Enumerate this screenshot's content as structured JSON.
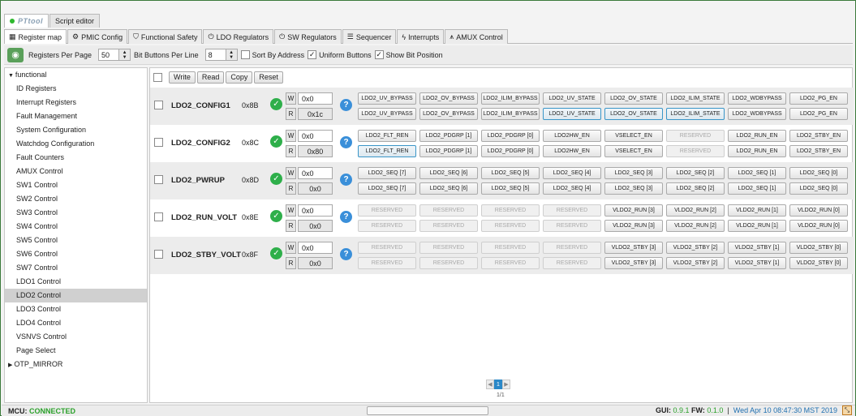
{
  "app_tabs": [
    {
      "label": "PTtool",
      "active": true
    },
    {
      "label": "Script editor",
      "active": false
    }
  ],
  "module_tabs": [
    {
      "label": "Register map",
      "icon": "grid-icon",
      "active": true
    },
    {
      "label": "PMIC Config",
      "icon": "gear-icon",
      "active": false
    },
    {
      "label": "Functional Safety",
      "icon": "shield-icon",
      "active": false
    },
    {
      "label": "LDO Regulators",
      "icon": "power-icon",
      "active": false
    },
    {
      "label": "SW Regulators",
      "icon": "power-icon",
      "active": false
    },
    {
      "label": "Sequencer",
      "icon": "list-icon",
      "active": false
    },
    {
      "label": "Interrupts",
      "icon": "lightning-icon",
      "active": false
    },
    {
      "label": "AMUX Control",
      "icon": "mux-icon",
      "active": false
    }
  ],
  "toolbar": {
    "regs_per_page_label": "Registers Per Page",
    "regs_per_page_value": "50",
    "bits_per_line_label": "Bit Buttons Per Line",
    "bits_per_line_value": "8",
    "sort_by_address_label": "Sort By Address",
    "sort_by_address_checked": false,
    "uniform_buttons_label": "Uniform Buttons",
    "uniform_buttons_checked": true,
    "show_bit_position_label": "Show Bit Position",
    "show_bit_position_checked": true
  },
  "sidebar": {
    "groups": [
      {
        "label": "functional",
        "expanded": true,
        "items": [
          "ID Registers",
          "Interrupt Registers",
          "Fault Management",
          "System Configuration",
          "Watchdog Configuration",
          "Fault Counters",
          "AMUX Control",
          "SW1 Control",
          "SW2 Control",
          "SW3 Control",
          "SW4 Control",
          "SW5 Control",
          "SW6 Control",
          "SW7 Control",
          "LDO1 Control",
          "LDO2 Control",
          "LDO3 Control",
          "LDO4 Control",
          "VSNVS Control",
          "Page Select"
        ]
      },
      {
        "label": "OTP_MIRROR",
        "expanded": false,
        "items": []
      }
    ],
    "selected": "LDO2 Control"
  },
  "actions": {
    "write": "Write",
    "read": "Read",
    "copy": "Copy",
    "reset": "Reset"
  },
  "labels": {
    "write_short": "W",
    "read_short": "R",
    "help": "?",
    "check": "✓"
  },
  "registers": [
    {
      "name": "LDO2_CONFIG1",
      "addr": "0x8B",
      "write_value": "0x0",
      "read_value": "0x1c",
      "bits": [
        "LDO2_UV_BYPASS",
        "LDO2_OV_BYPASS",
        "LDO2_ILIM_BYPASS",
        "LDO2_UV_STATE",
        "LDO2_OV_STATE",
        "LDO2_ILIM_STATE",
        "LDO2_WDBYPASS",
        "LDO2_PG_EN"
      ],
      "read_active": [
        false,
        false,
        false,
        true,
        true,
        true,
        false,
        false
      ],
      "disabled": [
        false,
        false,
        false,
        false,
        false,
        false,
        false,
        false
      ]
    },
    {
      "name": "LDO2_CONFIG2",
      "addr": "0x8C",
      "write_value": "0x0",
      "read_value": "0x80",
      "bits": [
        "LDO2_FLT_REN",
        "LDO2_PDGRP [1]",
        "LDO2_PDGRP [0]",
        "LDO2HW_EN",
        "VSELECT_EN",
        "RESERVED",
        "LDO2_RUN_EN",
        "LDO2_STBY_EN"
      ],
      "read_active": [
        true,
        false,
        false,
        false,
        false,
        false,
        false,
        false
      ],
      "disabled": [
        false,
        false,
        false,
        false,
        false,
        true,
        false,
        false
      ]
    },
    {
      "name": "LDO2_PWRUP",
      "addr": "0x8D",
      "write_value": "0x0",
      "read_value": "0x0",
      "bits": [
        "LDO2_SEQ [7]",
        "LDO2_SEQ [6]",
        "LDO2_SEQ [5]",
        "LDO2_SEQ [4]",
        "LDO2_SEQ [3]",
        "LDO2_SEQ [2]",
        "LDO2_SEQ [1]",
        "LDO2_SEQ [0]"
      ],
      "read_active": [
        false,
        false,
        false,
        false,
        false,
        false,
        false,
        false
      ],
      "disabled": [
        false,
        false,
        false,
        false,
        false,
        false,
        false,
        false
      ]
    },
    {
      "name": "LDO2_RUN_VOLT",
      "addr": "0x8E",
      "write_value": "0x0",
      "read_value": "0x0",
      "bits": [
        "RESERVED",
        "RESERVED",
        "RESERVED",
        "RESERVED",
        "VLDO2_RUN [3]",
        "VLDO2_RUN [2]",
        "VLDO2_RUN [1]",
        "VLDO2_RUN [0]"
      ],
      "read_active": [
        false,
        false,
        false,
        false,
        false,
        false,
        false,
        false
      ],
      "disabled": [
        true,
        true,
        true,
        true,
        false,
        false,
        false,
        false
      ]
    },
    {
      "name": "LDO2_STBY_VOLT",
      "addr": "0x8F",
      "write_value": "0x0",
      "read_value": "0x0",
      "bits": [
        "RESERVED",
        "RESERVED",
        "RESERVED",
        "RESERVED",
        "VLDO2_STBY [3]",
        "VLDO2_STBY [2]",
        "VLDO2_STBY [1]",
        "VLDO2_STBY [0]"
      ],
      "read_active": [
        false,
        false,
        false,
        false,
        false,
        false,
        false,
        false
      ],
      "disabled": [
        true,
        true,
        true,
        true,
        false,
        false,
        false,
        false
      ]
    }
  ],
  "pager": {
    "prev": "◀",
    "current": "1",
    "next": "▶",
    "info": "1/1"
  },
  "status": {
    "mcu_label": "MCU:",
    "mcu_value": "CONNECTED",
    "gui_label": "GUI:",
    "gui_version": "0.9.1",
    "fw_label": "FW:",
    "fw_version": "0.1.0",
    "datetime": "Wed Apr 10 08:47:30 MST 2019"
  },
  "colors": {
    "accent": "#2a88c8",
    "ok": "#2eaf4a",
    "connected": "#2aa02a"
  }
}
